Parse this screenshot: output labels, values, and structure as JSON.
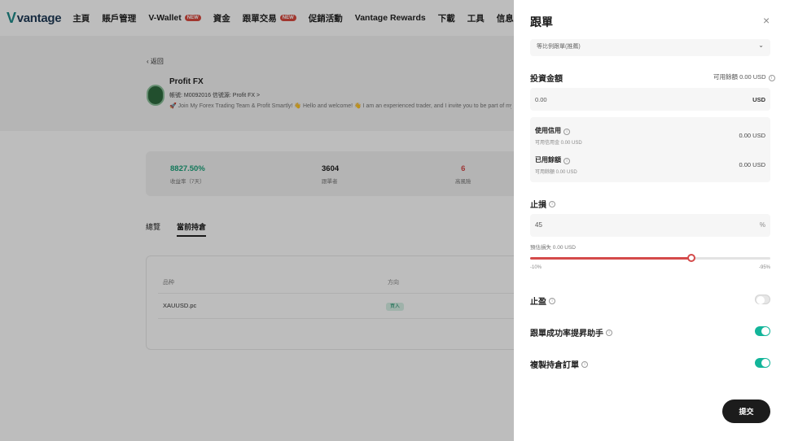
{
  "nav": {
    "logo": "vantage",
    "items": [
      {
        "label": "主頁"
      },
      {
        "label": "賬戶管理"
      },
      {
        "label": "V-Wallet",
        "badge": "NEW"
      },
      {
        "label": "資金"
      },
      {
        "label": "跟單交易",
        "badge": "NEW"
      },
      {
        "label": "促銷活動"
      },
      {
        "label": "Vantage Rewards"
      },
      {
        "label": "下載"
      },
      {
        "label": "工具"
      },
      {
        "label": "信息"
      }
    ]
  },
  "page": {
    "back": "返回",
    "profile": {
      "name": "Profit FX",
      "meta": "帳號: M0092016   信號源: Profit FX >",
      "bio": "🚀 Join My Forex Trading Team & Profit Smartly! 👋 Hello and welcome! 👋 I am an experienced trader, and I invite you to be part of my journey"
    },
    "stats": [
      {
        "value": "8827.50%",
        "label": "收益率（7天）",
        "color": "#1aa37a"
      },
      {
        "value": "3604",
        "label": "跟單者",
        "color": "#222222"
      },
      {
        "value": "6",
        "label": "高風險",
        "color": "#d44a4a"
      }
    ],
    "tabs": [
      "總覽",
      "當前持倉"
    ],
    "table": {
      "headers": [
        "品种",
        "方向"
      ],
      "row": {
        "symbol": "XAUUSD.pc",
        "direction": "買入"
      }
    }
  },
  "drawer": {
    "title": "跟單",
    "close": "×",
    "select_value": "等比例跟單(推薦)",
    "invest_label": "投資金額",
    "available": "可用餘額 0.00 USD",
    "amount_value": "0.00",
    "amount_unit": "USD",
    "credit": {
      "use_label": "使用信用",
      "use_sub": "可用信用金 0.00 USD",
      "use_value": "0.00 USD",
      "bonus_label": "已用餘額",
      "bonus_sub": "可用餘額 0.00 USD",
      "bonus_value": "0.00 USD"
    },
    "stop_loss_label": "止損",
    "stop_loss_value": "45",
    "stop_loss_unit": "%",
    "est_loss": "預估損失 0.00 USD",
    "slider": {
      "min_label": "-10%",
      "max_label": "-95%",
      "value_fraction": 0.67
    },
    "take_profit_label": "止盈",
    "take_profit_on": false,
    "assist_label": "跟單成功率提昇助手",
    "assist_on": true,
    "copy_label": "複製持倉訂單",
    "copy_on": true,
    "submit": "提交"
  }
}
